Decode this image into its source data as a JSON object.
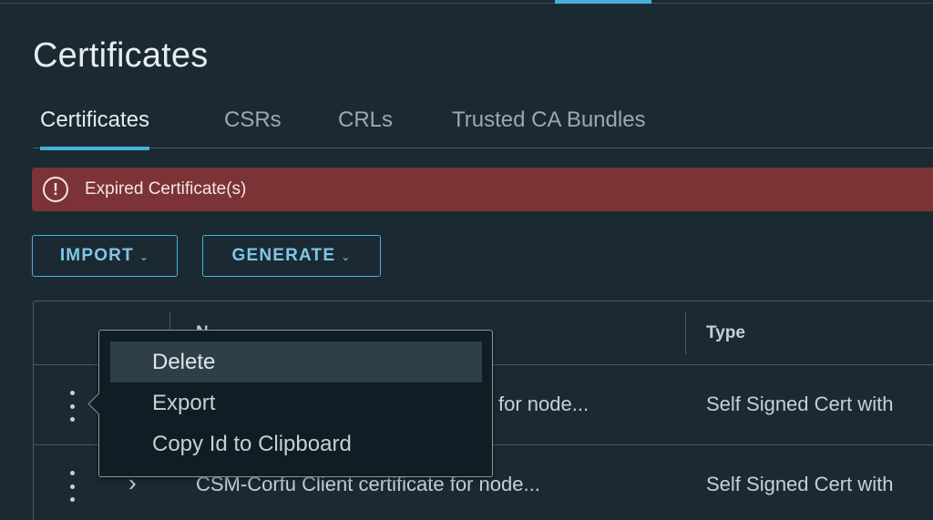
{
  "page": {
    "title": "Certificates"
  },
  "tabs": [
    {
      "label": "Certificates",
      "active": true
    },
    {
      "label": "CSRs",
      "active": false
    },
    {
      "label": "CRLs",
      "active": false
    },
    {
      "label": "Trusted CA Bundles",
      "active": false
    }
  ],
  "alert": {
    "text": "Expired Certificate(s)",
    "icon": "exclamation-circle-icon",
    "color": "#7c3335"
  },
  "toolbar": {
    "import_label": "IMPORT",
    "generate_label": "GENERATE"
  },
  "grid": {
    "columns": [
      {
        "label": "N"
      },
      {
        "label": "Type"
      }
    ],
    "rows": [
      {
        "name": "for node...",
        "type": "Self Signed Cert with"
      },
      {
        "name": "CSM-Corfu Client certificate for node...",
        "type": "Self Signed Cert with"
      }
    ]
  },
  "context_menu": {
    "items": [
      {
        "label": "Delete",
        "hover": true
      },
      {
        "label": "Export",
        "hover": false
      },
      {
        "label": "Copy Id to Clipboard",
        "hover": false
      }
    ]
  },
  "colors": {
    "accent": "#49afd9",
    "background": "#1b2a32",
    "alert": "#7c3335"
  }
}
